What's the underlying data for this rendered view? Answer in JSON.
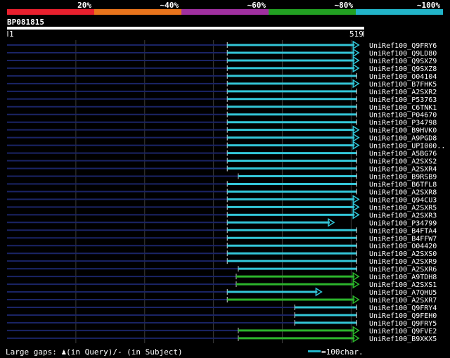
{
  "legend": {
    "labels": [
      "20%",
      "~40%",
      "~60%",
      "~80%",
      "~100%"
    ],
    "colors": [
      "#e8202e",
      "#e8741c",
      "#a030a0",
      "#22a022",
      "#22b4c8"
    ]
  },
  "query": {
    "id": "BP081815",
    "start": "1",
    "end": "519",
    "length": 519
  },
  "hits": [
    {
      "name": "UniRef100_Q9FRY6",
      "start": 320,
      "end": 508,
      "color": "cyan",
      "arrow": true
    },
    {
      "name": "UniRef100_Q9LD80",
      "start": 320,
      "end": 508,
      "color": "cyan",
      "arrow": true
    },
    {
      "name": "UniRef100_Q9SXZ9",
      "start": 320,
      "end": 508,
      "color": "cyan",
      "arrow": true
    },
    {
      "name": "UniRef100_Q9SXZ8",
      "start": 320,
      "end": 508,
      "color": "cyan",
      "arrow": true
    },
    {
      "name": "UniRef100_O04104",
      "start": 320,
      "end": 508,
      "color": "cyan",
      "arrow": false
    },
    {
      "name": "UniRef100_B7FHK5",
      "start": 320,
      "end": 508,
      "color": "cyan",
      "arrow": true
    },
    {
      "name": "UniRef100_A2SXR2",
      "start": 320,
      "end": 508,
      "color": "cyan",
      "arrow": false
    },
    {
      "name": "UniRef100_P53763",
      "start": 320,
      "end": 508,
      "color": "cyan",
      "arrow": false
    },
    {
      "name": "UniRef100_C6TNK1",
      "start": 320,
      "end": 508,
      "color": "cyan",
      "arrow": false
    },
    {
      "name": "UniRef100_P04670",
      "start": 320,
      "end": 508,
      "color": "cyan",
      "arrow": false
    },
    {
      "name": "UniRef100_P34798",
      "start": 320,
      "end": 508,
      "color": "cyan",
      "arrow": false
    },
    {
      "name": "UniRef100_B9HVK0",
      "start": 320,
      "end": 508,
      "color": "cyan",
      "arrow": true
    },
    {
      "name": "UniRef100_A9PGD8",
      "start": 320,
      "end": 508,
      "color": "cyan",
      "arrow": true
    },
    {
      "name": "UniRef100_UPI000..",
      "start": 320,
      "end": 508,
      "color": "cyan",
      "arrow": true
    },
    {
      "name": "UniRef100_A5BG76",
      "start": 320,
      "end": 508,
      "color": "cyan",
      "arrow": false
    },
    {
      "name": "UniRef100_A2SXS2",
      "start": 320,
      "end": 508,
      "color": "cyan",
      "arrow": false
    },
    {
      "name": "UniRef100_A2SXR4",
      "start": 320,
      "end": 508,
      "color": "cyan",
      "arrow": false
    },
    {
      "name": "UniRef100_B9RSB9",
      "start": 336,
      "end": 508,
      "color": "cyan",
      "arrow": false
    },
    {
      "name": "UniRef100_B6TFL8",
      "start": 320,
      "end": 508,
      "color": "cyan",
      "arrow": false
    },
    {
      "name": "UniRef100_A2SXR8",
      "start": 320,
      "end": 508,
      "color": "cyan",
      "arrow": false
    },
    {
      "name": "UniRef100_Q94CU3",
      "start": 320,
      "end": 508,
      "color": "cyan",
      "arrow": true
    },
    {
      "name": "UniRef100_A2SXR5",
      "start": 320,
      "end": 508,
      "color": "cyan",
      "arrow": true
    },
    {
      "name": "UniRef100_A2SXR3",
      "start": 320,
      "end": 508,
      "color": "cyan",
      "arrow": true
    },
    {
      "name": "UniRef100_P34799",
      "start": 320,
      "end": 472,
      "color": "cyan",
      "arrow": true
    },
    {
      "name": "UniRef100_B4FTA4",
      "start": 320,
      "end": 508,
      "color": "cyan",
      "arrow": false
    },
    {
      "name": "UniRef100_B4FFW7",
      "start": 320,
      "end": 508,
      "color": "cyan",
      "arrow": false
    },
    {
      "name": "UniRef100_O04420",
      "start": 320,
      "end": 508,
      "color": "cyan",
      "arrow": false
    },
    {
      "name": "UniRef100_A2SXS0",
      "start": 320,
      "end": 508,
      "color": "cyan",
      "arrow": false
    },
    {
      "name": "UniRef100_A2SXR9",
      "start": 320,
      "end": 508,
      "color": "cyan",
      "arrow": false
    },
    {
      "name": "UniRef100_A2SXR6",
      "start": 336,
      "end": 508,
      "color": "cyan",
      "arrow": false
    },
    {
      "name": "UniRef100_A9TDH8",
      "start": 333,
      "end": 508,
      "color": "green",
      "arrow": true
    },
    {
      "name": "UniRef100_A2SXS1",
      "start": 333,
      "end": 508,
      "color": "green",
      "arrow": true
    },
    {
      "name": "UniRef100_A7QHU5",
      "start": 320,
      "end": 454,
      "color": "cyan",
      "arrow": true
    },
    {
      "name": "UniRef100_A2SXR7",
      "start": 320,
      "end": 508,
      "color": "green",
      "arrow": true
    },
    {
      "name": "UniRef100_Q9FRY4",
      "start": 418,
      "end": 508,
      "color": "cyan",
      "arrow": false
    },
    {
      "name": "UniRef100_Q9FEH0",
      "start": 418,
      "end": 508,
      "color": "cyan",
      "arrow": false
    },
    {
      "name": "UniRef100_Q9FRY5",
      "start": 418,
      "end": 508,
      "color": "cyan",
      "arrow": false
    },
    {
      "name": "UniRef100_Q9FVE2",
      "start": 336,
      "end": 508,
      "color": "green",
      "arrow": true
    },
    {
      "name": "UniRef100_B9XKX5",
      "start": 336,
      "end": 508,
      "color": "green",
      "arrow": true
    }
  ],
  "footer": {
    "gaps_text": "Large gaps: ♟(in Query)/- (in Subject)",
    "scale_text": "=100char."
  }
}
